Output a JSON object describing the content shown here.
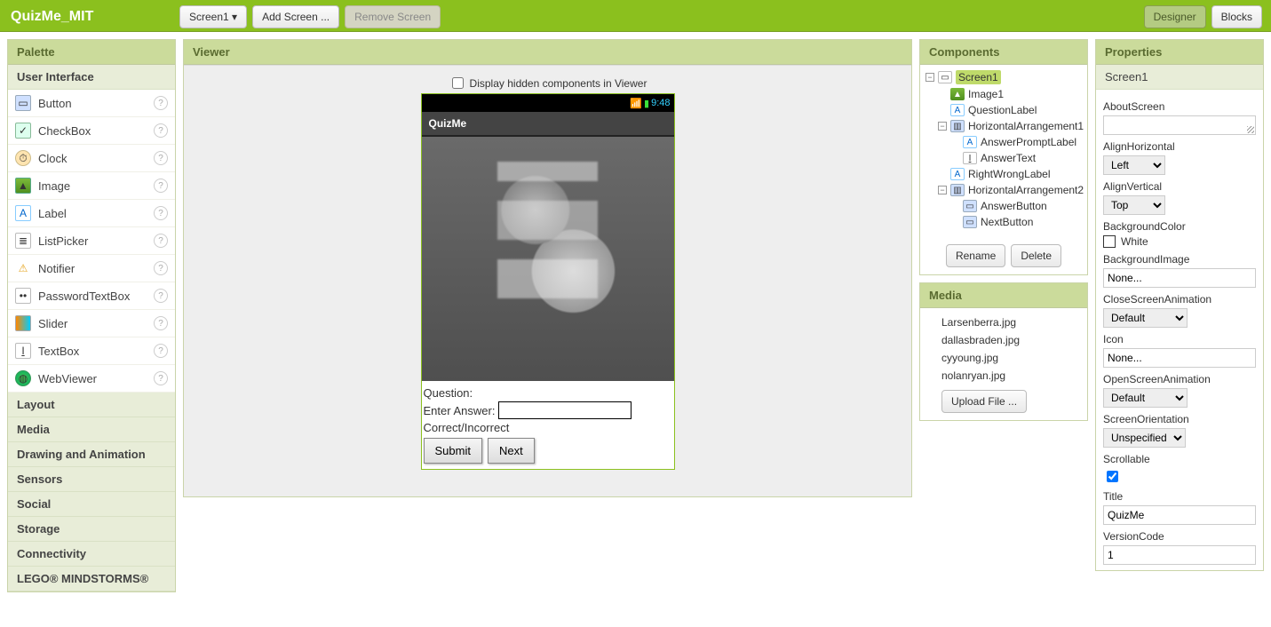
{
  "top": {
    "app_name": "QuizMe_MIT",
    "screen_dropdown": "Screen1 ▾",
    "add_screen": "Add Screen ...",
    "remove_screen": "Remove Screen",
    "designer": "Designer",
    "blocks": "Blocks"
  },
  "palette": {
    "title": "Palette",
    "subheader": "User Interface",
    "items": [
      {
        "label": "Button"
      },
      {
        "label": "CheckBox"
      },
      {
        "label": "Clock"
      },
      {
        "label": "Image"
      },
      {
        "label": "Label"
      },
      {
        "label": "ListPicker"
      },
      {
        "label": "Notifier"
      },
      {
        "label": "PasswordTextBox"
      },
      {
        "label": "Slider"
      },
      {
        "label": "TextBox"
      },
      {
        "label": "WebViewer"
      }
    ],
    "categories": [
      "Layout",
      "Media",
      "Drawing and Animation",
      "Sensors",
      "Social",
      "Storage",
      "Connectivity",
      "LEGO® MINDSTORMS®"
    ]
  },
  "viewer": {
    "title": "Viewer",
    "hidden_checkbox": "Display hidden components in Viewer",
    "status_time": "9:48",
    "app_title": "QuizMe",
    "question_label": "Question:",
    "answer_prompt": "Enter Answer:",
    "rightwrong": "Correct/Incorrect",
    "submit": "Submit",
    "next": "Next"
  },
  "components": {
    "title": "Components",
    "tree": {
      "screen": "Screen1",
      "image": "Image1",
      "question": "QuestionLabel",
      "ha1": "HorizontalArrangement1",
      "apl": "AnswerPromptLabel",
      "atxt": "AnswerText",
      "rwl": "RightWrongLabel",
      "ha2": "HorizontalArrangement2",
      "abtn": "AnswerButton",
      "nbtn": "NextButton"
    },
    "rename": "Rename",
    "delete": "Delete"
  },
  "media": {
    "title": "Media",
    "files": [
      "Larsenberra.jpg",
      "dallasbraden.jpg",
      "cyyoung.jpg",
      "nolanryan.jpg"
    ],
    "upload": "Upload File ..."
  },
  "properties": {
    "title": "Properties",
    "target": "Screen1",
    "about_label": "AboutScreen",
    "about_value": "",
    "alignh_label": "AlignHorizontal",
    "alignh_value": "Left",
    "alignv_label": "AlignVertical",
    "alignv_value": "Top",
    "bgcolor_label": "BackgroundColor",
    "bgcolor_value": "White",
    "bgimage_label": "BackgroundImage",
    "bgimage_value": "None...",
    "closeanim_label": "CloseScreenAnimation",
    "closeanim_value": "Default",
    "icon_label": "Icon",
    "icon_value": "None...",
    "openanim_label": "OpenScreenAnimation",
    "openanim_value": "Default",
    "orient_label": "ScreenOrientation",
    "orient_value": "Unspecified",
    "scroll_label": "Scrollable",
    "scroll_checked": true,
    "title_label": "Title",
    "title_value": "QuizMe",
    "version_label": "VersionCode",
    "version_value": "1"
  }
}
